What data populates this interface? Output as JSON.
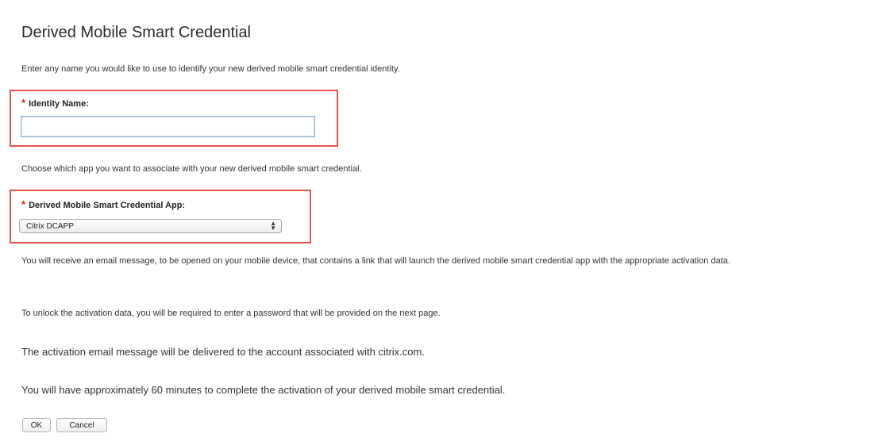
{
  "page": {
    "title": "Derived Mobile Smart Credential",
    "intro": "Enter any name you would like to use to identify your new derived mobile smart credential identity."
  },
  "identity_field": {
    "required_mark": "*",
    "label": "Identity Name:",
    "value": "",
    "placeholder": ""
  },
  "app_intro": "Choose which app you want to associate with your new derived mobile smart credential.",
  "app_field": {
    "required_mark": "*",
    "label": "Derived Mobile Smart Credential App:",
    "selected": "Citrix DCAPP"
  },
  "info": {
    "email_notice": "You will receive an email message, to be opened on your mobile device, that contains a link that will launch the derived mobile smart credential app with the appropriate activation data.",
    "unlock_notice": "To unlock the activation data, you will be required to enter a password that will be provided on the next page.",
    "delivery_notice": "The activation email message will be delivered to the account associated with citrix.com.",
    "time_notice": "You will have approximately 60 minutes to complete the activation of your derived mobile smart credential."
  },
  "buttons": {
    "ok": "OK",
    "cancel": "Cancel"
  },
  "colors": {
    "highlight": "#e8534a",
    "required": "#d9261c"
  }
}
